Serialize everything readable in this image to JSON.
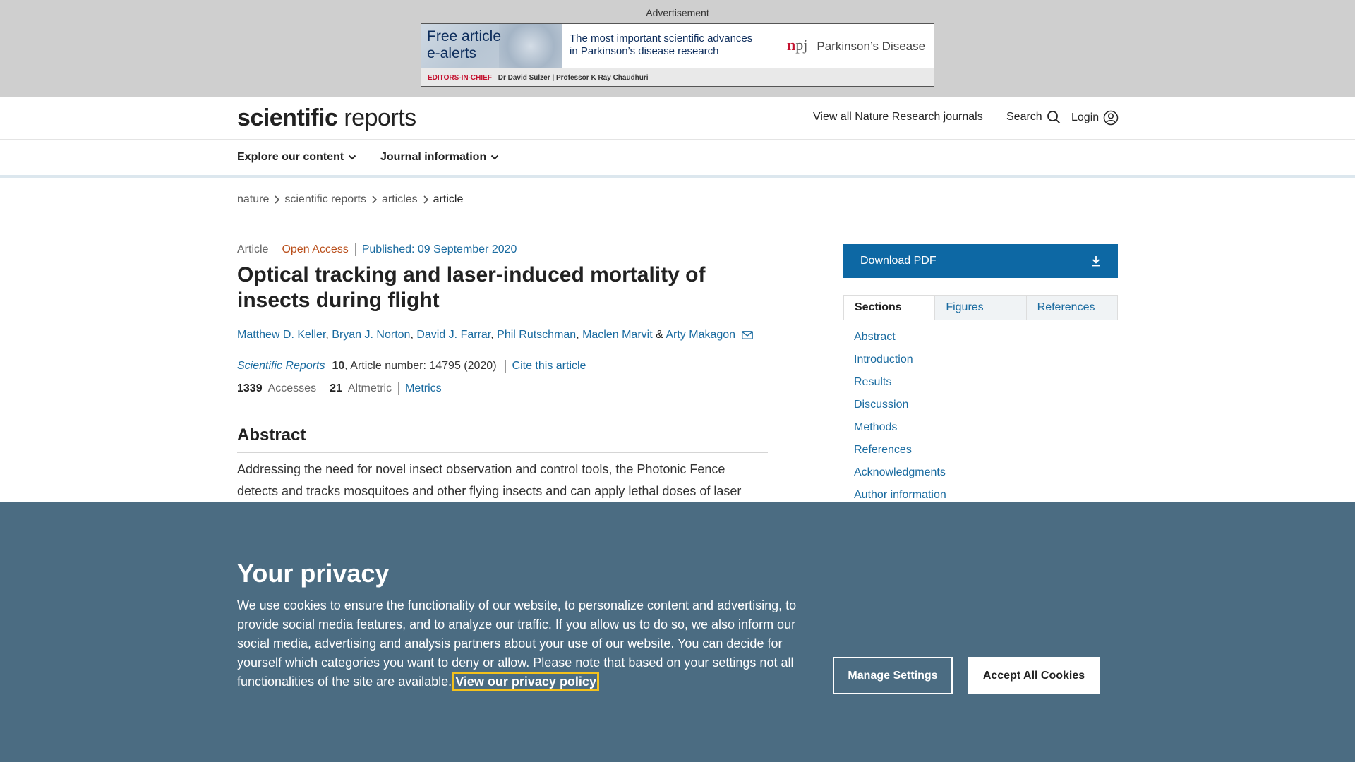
{
  "ad": {
    "label": "Advertisement",
    "free_line1": "Free article",
    "free_line2": "e-alerts",
    "mid_line1": "The most important scientific advances",
    "mid_line2": "in Parkinson’s disease research",
    "brand_n": "n",
    "brand_pj": "pj",
    "brand_name": "Parkinson’s Disease",
    "eic_label": "EDITORS-IN-CHIEF",
    "editors": "Dr David Sulzer | Professor K Ray Chaudhuri"
  },
  "header": {
    "logo_bold": "scientific",
    "logo_regular": " reports",
    "journals_link": "View all Nature Research journals",
    "search_label": "Search",
    "login_label": "Login"
  },
  "nav": {
    "explore": "Explore our content",
    "journal_info": "Journal information"
  },
  "breadcrumb": [
    "nature",
    "scientific reports",
    "articles",
    "article"
  ],
  "article": {
    "type": "Article",
    "access": "Open Access",
    "published": "Published: 09 September 2020",
    "title": "Optical tracking and laser-induced mortality of insects during flight",
    "authors": [
      "Matthew D. Keller",
      "Bryan J. Norton",
      "David J. Farrar",
      "Phil Rutschman",
      "Maclen Marvit",
      "Arty Makagon"
    ],
    "journal": "Scientific Reports",
    "volume": "10",
    "article_number": ", Article number: 14795 (2020)",
    "cite_label": "Cite this article",
    "accesses_count": "1339",
    "accesses_label": "Accesses",
    "altmetric_count": "21",
    "altmetric_label": "Altmetric",
    "metrics_label": "Metrics",
    "abstract_heading": "Abstract",
    "abstract_text": "Addressing the need for novel insect observation and control tools, the Photonic Fence detects and tracks mosquitoes and other flying insects and can apply lethal doses of laser"
  },
  "sidebar": {
    "download_pdf": "Download PDF",
    "tabs": [
      "Sections",
      "Figures",
      "References"
    ],
    "sections": [
      "Abstract",
      "Introduction",
      "Results",
      "Discussion",
      "Methods",
      "References",
      "Acknowledgments",
      "Author information"
    ]
  },
  "cookie": {
    "title": "Your privacy",
    "text": "We use cookies to ensure the functionality of our website, to personalize content and advertising, to provide social media features, and to analyze our traffic. If you allow us to do so, we also inform our social media, advertising and analysis partners about your use of our website. You can decide for yourself which categories you want to deny or allow. Please note that based on your settings not all functionalities of the site are available.",
    "policy_link": "View our privacy policy",
    "manage_label": "Manage Settings",
    "accept_label": "Accept All Cookies"
  },
  "colors": {
    "link": "#1a6ba0",
    "open_access": "#b94e1a",
    "pdf_button": "#0d68a4",
    "cookie_bg": "#4b6c82",
    "focus_outline": "#f3c11c"
  }
}
